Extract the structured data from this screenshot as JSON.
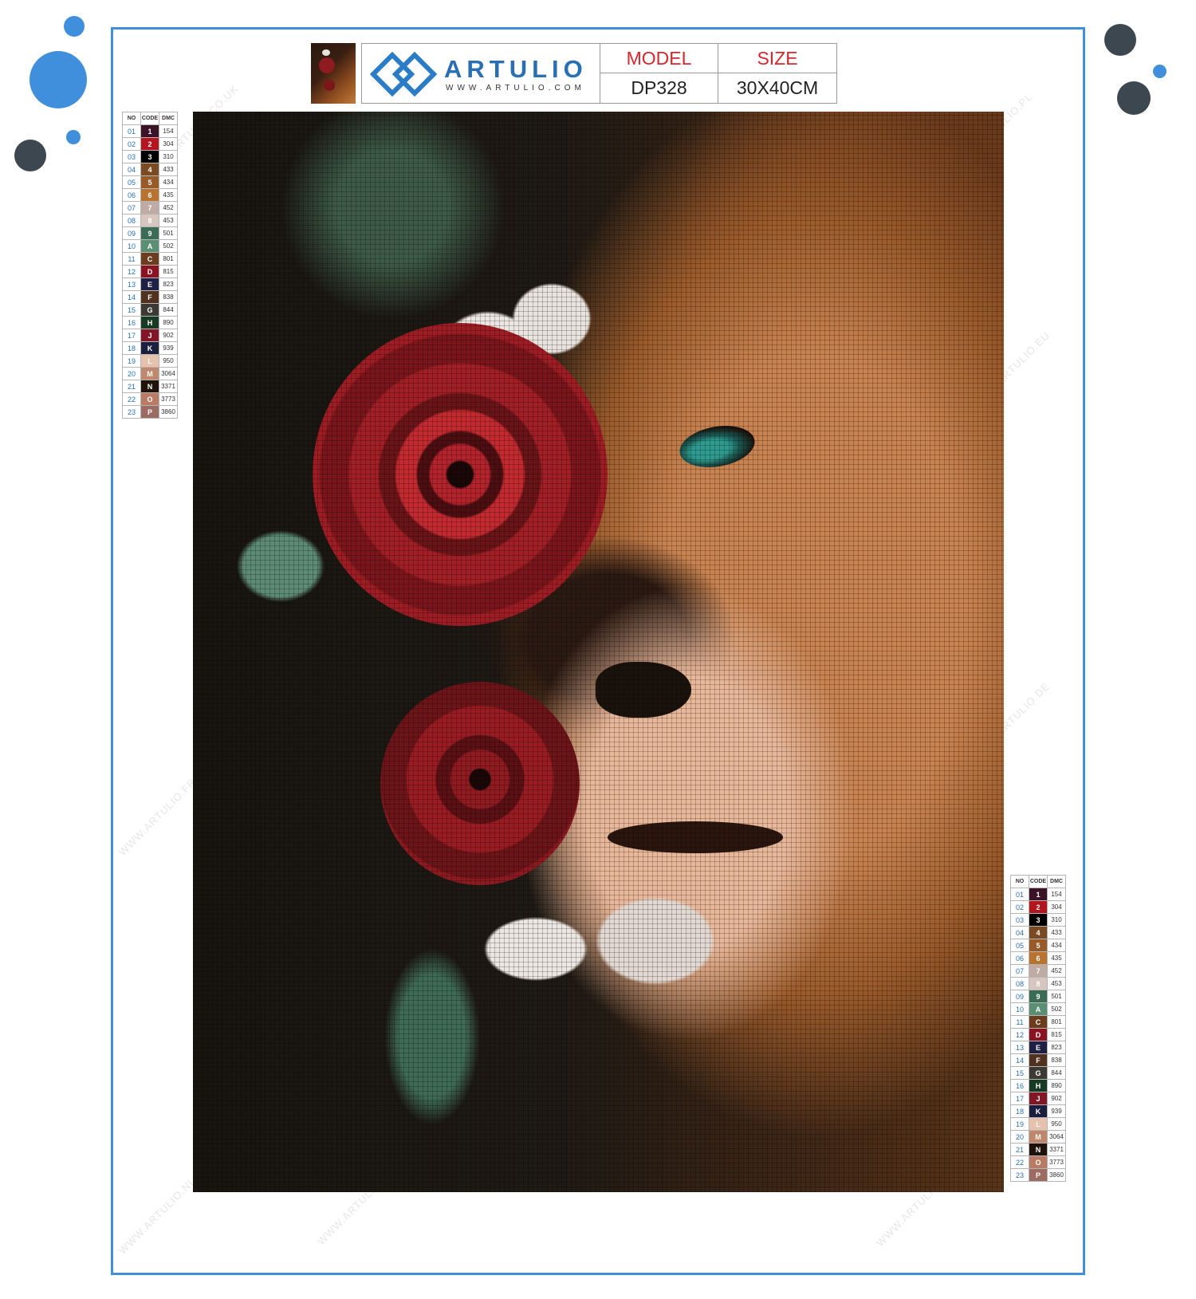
{
  "header": {
    "brand_name": "ARTULIO",
    "brand_url": "WWW.ARTULIO.COM",
    "model_label": "MODEL",
    "model_value": "DP328",
    "size_label": "SIZE",
    "size_value": "30X40CM"
  },
  "legend": {
    "col_no": "NO",
    "col_code": "CODE",
    "col_dmc": "DMC",
    "rows": [
      {
        "no": "01",
        "code": "1",
        "dmc": "154",
        "color": "#3b1226"
      },
      {
        "no": "02",
        "code": "2",
        "dmc": "304",
        "color": "#b3141d"
      },
      {
        "no": "03",
        "code": "3",
        "dmc": "310",
        "color": "#000000"
      },
      {
        "no": "04",
        "code": "4",
        "dmc": "433",
        "color": "#7a4a23"
      },
      {
        "no": "05",
        "code": "5",
        "dmc": "434",
        "color": "#985a27"
      },
      {
        "no": "06",
        "code": "6",
        "dmc": "435",
        "color": "#b8742e"
      },
      {
        "no": "07",
        "code": "7",
        "dmc": "452",
        "color": "#c0aaa4"
      },
      {
        "no": "08",
        "code": "8",
        "dmc": "453",
        "color": "#d6c6bf"
      },
      {
        "no": "09",
        "code": "9",
        "dmc": "501",
        "color": "#3a6b55"
      },
      {
        "no": "10",
        "code": "A",
        "dmc": "502",
        "color": "#5b8f74"
      },
      {
        "no": "11",
        "code": "C",
        "dmc": "801",
        "color": "#6b3d1c"
      },
      {
        "no": "12",
        "code": "D",
        "dmc": "815",
        "color": "#8a1221"
      },
      {
        "no": "13",
        "code": "E",
        "dmc": "823",
        "color": "#1e2145"
      },
      {
        "no": "14",
        "code": "F",
        "dmc": "838",
        "color": "#50321f"
      },
      {
        "no": "15",
        "code": "G",
        "dmc": "844",
        "color": "#3d3a35"
      },
      {
        "no": "16",
        "code": "H",
        "dmc": "890",
        "color": "#173a24"
      },
      {
        "no": "17",
        "code": "J",
        "dmc": "902",
        "color": "#821526"
      },
      {
        "no": "18",
        "code": "K",
        "dmc": "939",
        "color": "#1b1f3d"
      },
      {
        "no": "19",
        "code": "L",
        "dmc": "950",
        "color": "#e6c1ad"
      },
      {
        "no": "20",
        "code": "M",
        "dmc": "3064",
        "color": "#c0876d"
      },
      {
        "no": "21",
        "code": "N",
        "dmc": "3371",
        "color": "#1e120b"
      },
      {
        "no": "22",
        "code": "O",
        "dmc": "3773",
        "color": "#b97b63"
      },
      {
        "no": "23",
        "code": "P",
        "dmc": "3860",
        "color": "#9c6b62"
      }
    ]
  },
  "watermarks": [
    "WWW.ARTULIO.CO.UK",
    "WWW.ARTULIO.PL",
    "WWW.ARTULIO.EU",
    "WWW.ARTULIO.DE",
    "WWW.ARTULIO.FR",
    "WWW.ARTULIO.IT",
    "WWW.ARTULIO.ES",
    "WWW.ARTULIO.NL"
  ],
  "colors": {
    "frame": "#3f8fdc",
    "dot_blue": "#3f8fdc",
    "dot_dark": "#3c4750",
    "header_red": "#d9262c",
    "brand_blue": "#2a6fb3"
  }
}
